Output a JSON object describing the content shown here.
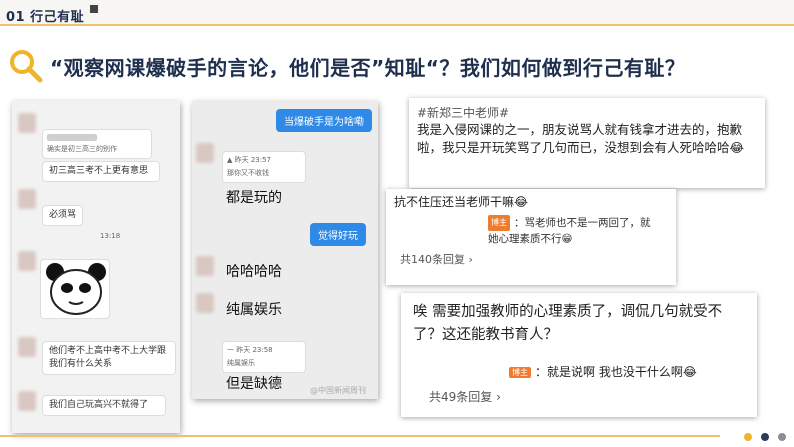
{
  "header": {
    "section_label": "01 行己有耻"
  },
  "title": "“观察网课爆破手的言论，他们是否”知耻“？我们如何做到行己有耻？",
  "chat1": {
    "quote_line": "确实是初三高三的别作",
    "line1": "初三高三考不上更有意思",
    "line2": "必须骂",
    "time": "13:18",
    "line3": "他们考不上高中考不上大学跟我们有什么关系",
    "line4": "我们自己玩高兴不就得了"
  },
  "chat2": {
    "blue1": "当爆破手是为啥嘞",
    "quote1_time": "▲ 昨天 23:57",
    "quote1_text": "那你又不收钱",
    "msg1": "都是玩的",
    "blue2": "觉得好玩",
    "msg2": "哈哈哈哈",
    "msg3": "纯属娱乐",
    "quote2_time": "一 昨天 23:58",
    "quote2_text": "纯属娱乐",
    "msg4": "但是缺德",
    "watermark": "@中国新闻周刊"
  },
  "comment1": {
    "tag": "#新郑三中老师#",
    "text": "我是入侵网课的之一，朋友说骂人就有钱拿才进去的，抱歉啦，我只是开玩笑骂了几句而已，没想到会有人死哈哈哈😂"
  },
  "comment2": {
    "text": "抗不住压还当老师干嘛😂",
    "badge": "博主",
    "reply": "：骂老师也不是一两回了，就她心理素质不行😁",
    "count": "共140条回复 ›"
  },
  "comment3": {
    "text": "唉 需要加强教师的心理素质了，调侃几句就受不了？这还能教书育人？",
    "badge": "博主",
    "reply": "：就是说啊 我也没干什么啊😂",
    "count": "共49条回复 ›"
  },
  "colors": {
    "accent": "#f0c36a",
    "navy": "#1f2f4e",
    "blue": "#2e8ae6",
    "dot1": "#f0b429",
    "dot2": "#2b3a55",
    "dot3": "#8a8f99"
  }
}
